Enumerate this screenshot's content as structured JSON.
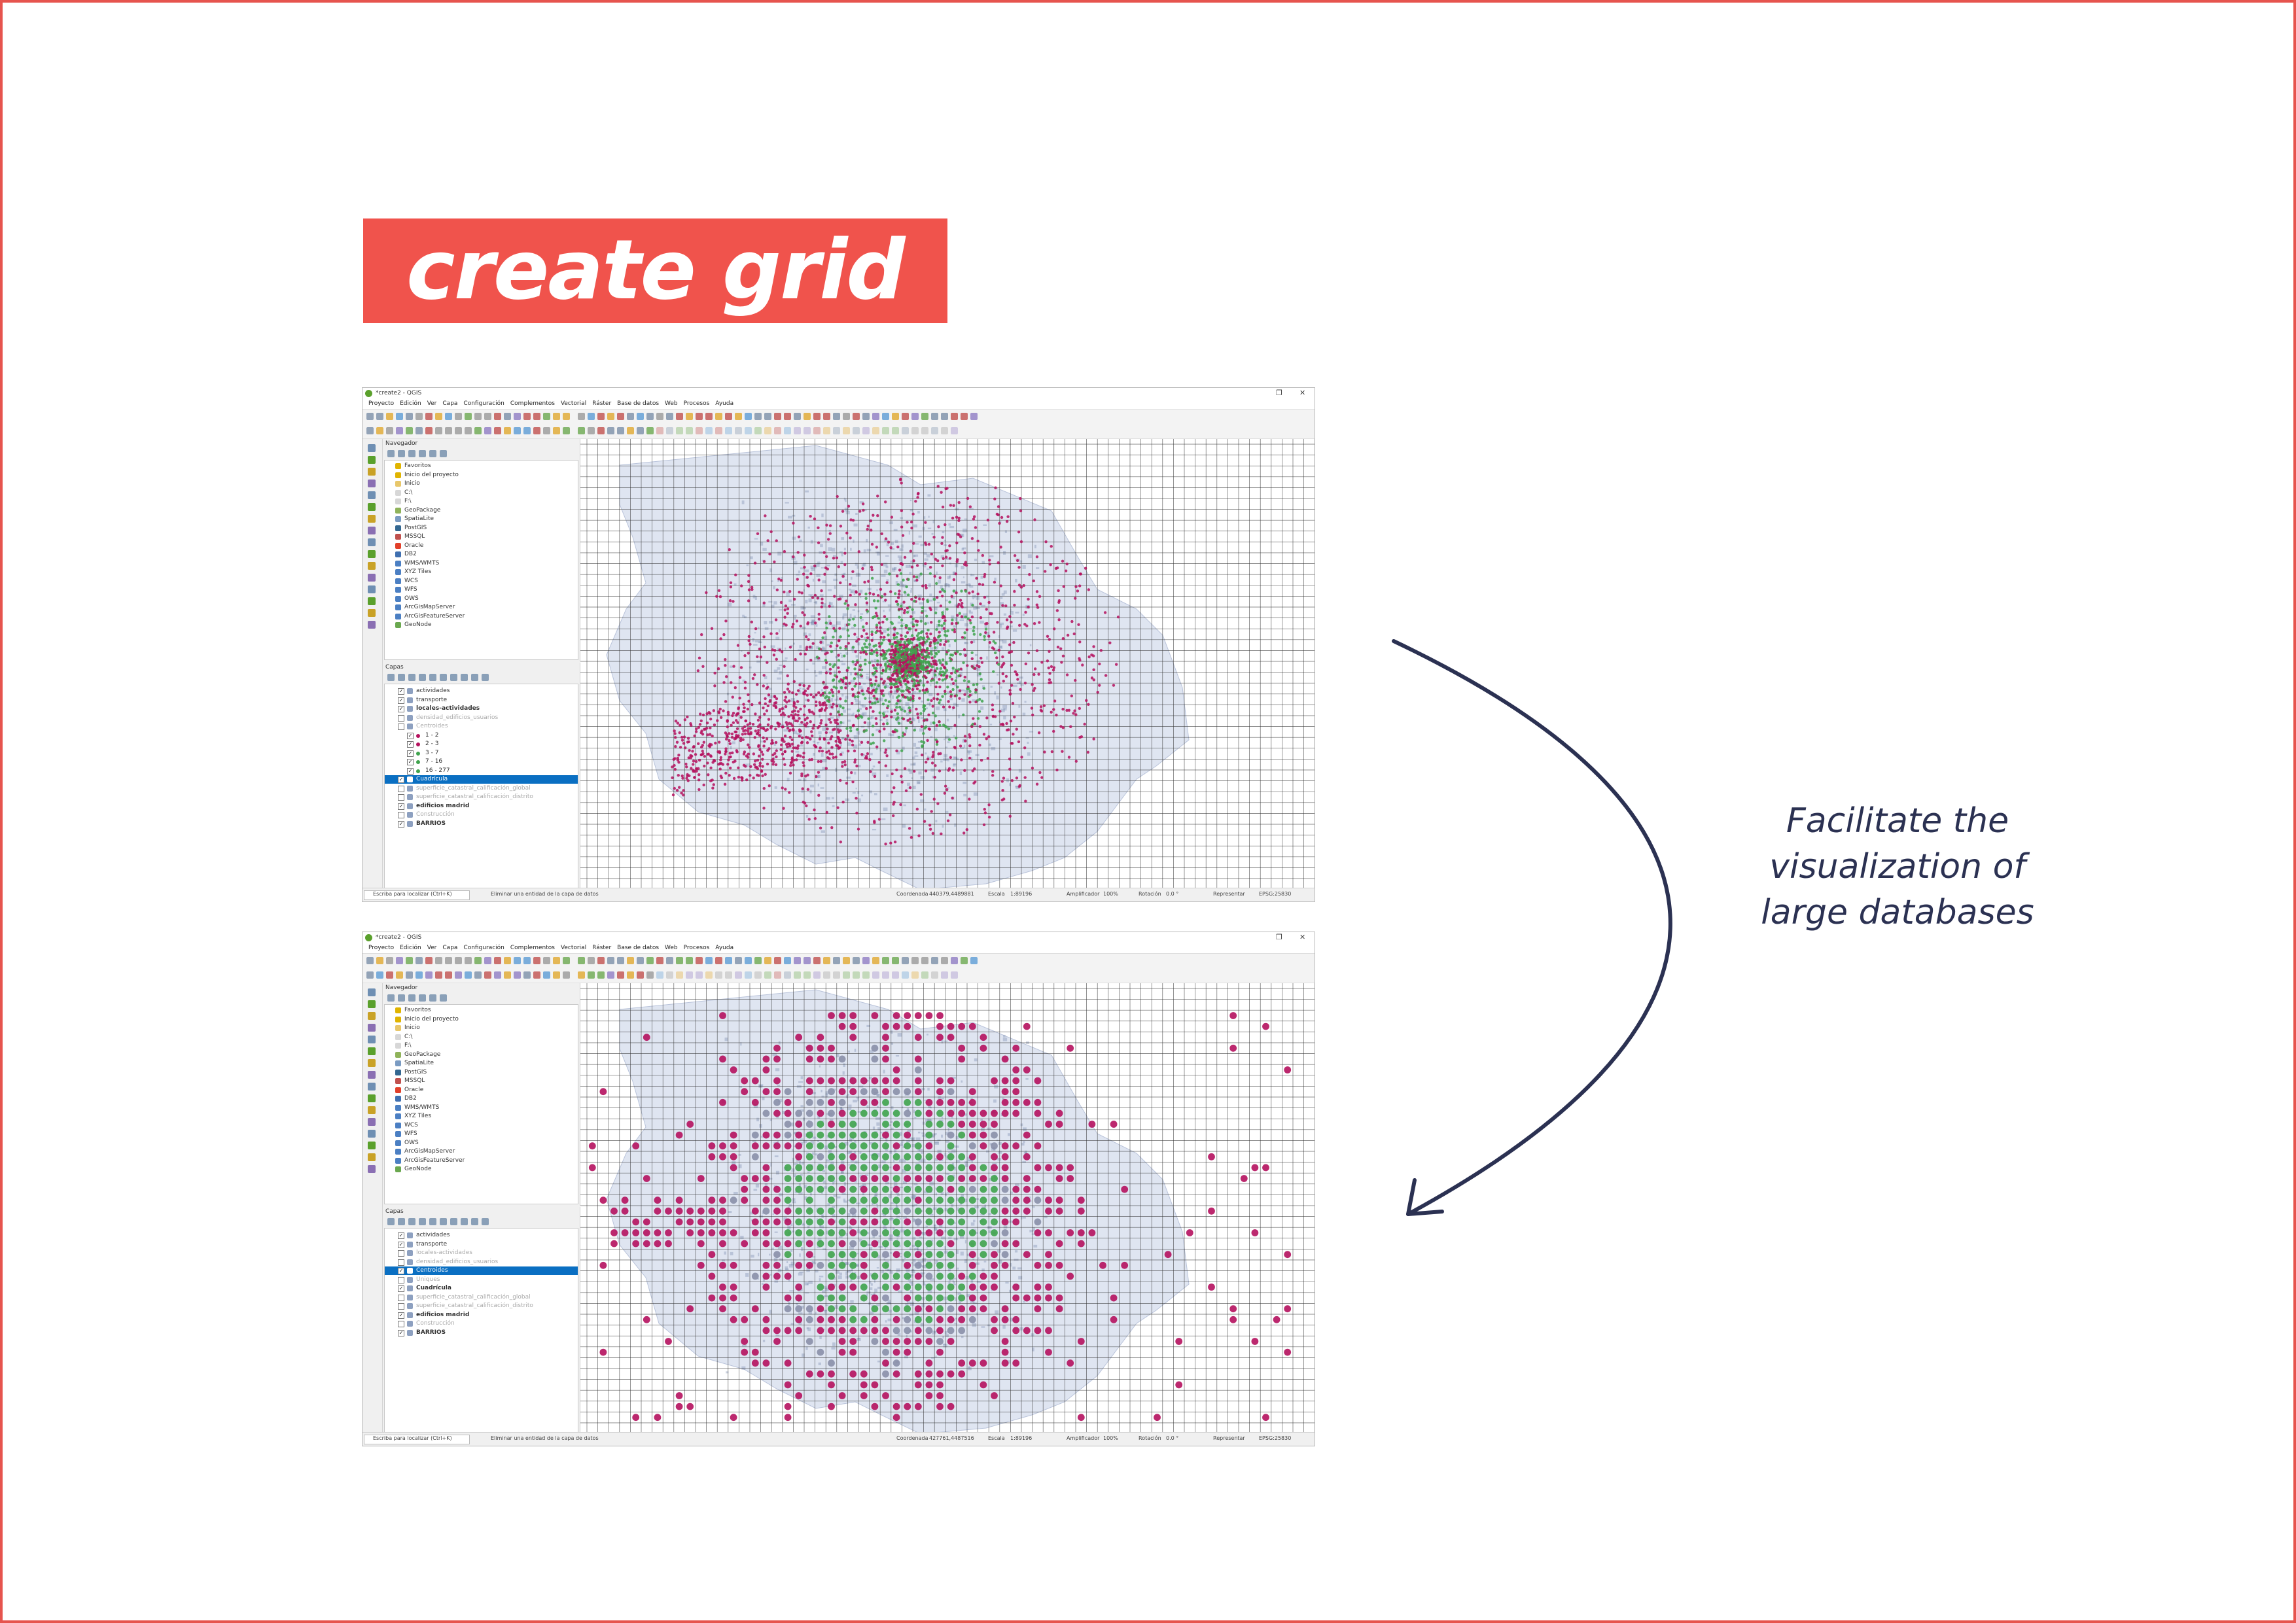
{
  "title": "create grid",
  "caption": {
    "line1": "Facilitate the",
    "line2": "visualization of",
    "line3": "large databases"
  },
  "colors": {
    "accent": "#f0534c",
    "arrow": "#2b3152",
    "selection": "#0a6fc2",
    "point_magenta": "#b5115e",
    "point_green": "#3fa34d",
    "map_fill": "#dfe5f1"
  },
  "window": {
    "title": "*create2 - QGIS",
    "menu": [
      "Proyecto",
      "Edición",
      "Ver",
      "Capa",
      "Configuración",
      "Complementos",
      "Vectorial",
      "Ráster",
      "Base de datos",
      "Web",
      "Procesos",
      "Ayuda"
    ],
    "browser_panel_title": "Navegador",
    "layers_panel_title": "Capas",
    "browser_items": [
      "Favoritos",
      "Inicio del proyecto",
      "Inicio",
      "C:\\",
      "F:\\",
      "GeoPackage",
      "SpatiaLite",
      "PostGIS",
      "MSSQL",
      "Oracle",
      "DB2",
      "WMS/WMTS",
      "XYZ Tiles",
      "WCS",
      "WFS",
      "OWS",
      "ArcGisMapServer",
      "ArcGisFeatureServer",
      "GeoNode"
    ]
  },
  "screenshot_top": {
    "layers": [
      {
        "label": "actividades",
        "checked": true,
        "style": "normal"
      },
      {
        "label": "transporte",
        "checked": true,
        "style": "normal"
      },
      {
        "label": "locales-actividades",
        "checked": true,
        "style": "bold"
      },
      {
        "label": "densidad_edificios_usuarios",
        "checked": false,
        "style": "dim"
      },
      {
        "label": "Centroides",
        "checked": false,
        "style": "dim"
      },
      {
        "label": "1 - 2",
        "checked": true,
        "style": "legend"
      },
      {
        "label": "2 - 3",
        "checked": true,
        "style": "legend"
      },
      {
        "label": "3 - 7",
        "checked": true,
        "style": "legend"
      },
      {
        "label": "7 - 16",
        "checked": true,
        "style": "legend"
      },
      {
        "label": "16 - 277",
        "checked": true,
        "style": "legend"
      },
      {
        "label": "Cuadrícula",
        "checked": true,
        "style": "selected"
      },
      {
        "label": "superficie_catastral_calificación_global",
        "checked": false,
        "style": "dim"
      },
      {
        "label": "superficie_catastral_calificación_distrito",
        "checked": false,
        "style": "dim"
      },
      {
        "label": "edificios madrid",
        "checked": true,
        "style": "bold"
      },
      {
        "label": "Construcción",
        "checked": false,
        "style": "dim"
      },
      {
        "label": "BARRIOS",
        "checked": true,
        "style": "bold"
      }
    ],
    "status": {
      "search_placeholder": "Escriba para localizar (Ctrl+K)",
      "message": "Eliminar una entidad de la capa de datos",
      "coordinate_label": "Coordenada",
      "coordinate_value": "440379,4489881",
      "scale_label": "Escala",
      "scale_value": "1:89196",
      "magnifier_label": "Amplificador",
      "magnifier_value": "100%",
      "rotation_label": "Rotación",
      "rotation_value": "0.0 °",
      "render_label": "Representar",
      "crs": "EPSG:25830"
    }
  },
  "screenshot_bottom": {
    "layers": [
      {
        "label": "actividades",
        "checked": true,
        "style": "normal"
      },
      {
        "label": "transporte",
        "checked": true,
        "style": "normal"
      },
      {
        "label": "locales-actividades",
        "checked": false,
        "style": "dim"
      },
      {
        "label": "densidad_edificios_usuarios",
        "checked": false,
        "style": "dim"
      },
      {
        "label": "Centroides",
        "checked": true,
        "style": "selected"
      },
      {
        "label": "Uniques",
        "checked": false,
        "style": "dim"
      },
      {
        "label": "Cuadrícula",
        "checked": true,
        "style": "bold"
      },
      {
        "label": "superficie_catastral_calificación_global",
        "checked": false,
        "style": "dim"
      },
      {
        "label": "superficie_catastral_calificación_distrito",
        "checked": false,
        "style": "dim"
      },
      {
        "label": "edificios madrid",
        "checked": true,
        "style": "bold"
      },
      {
        "label": "Construcción",
        "checked": false,
        "style": "dim"
      },
      {
        "label": "BARRIOS",
        "checked": true,
        "style": "bold"
      }
    ],
    "status": {
      "search_placeholder": "Escriba para localizar (Ctrl+K)",
      "message": "Eliminar una entidad de la capa de datos",
      "coordinate_label": "Coordenada",
      "coordinate_value": "427761,4487516",
      "scale_label": "Escala",
      "scale_value": "1:89196",
      "magnifier_label": "Amplificador",
      "magnifier_value": "100%",
      "rotation_label": "Rotación",
      "rotation_value": "0.0 °",
      "render_label": "Representar",
      "crs": "EPSG:25830"
    }
  }
}
